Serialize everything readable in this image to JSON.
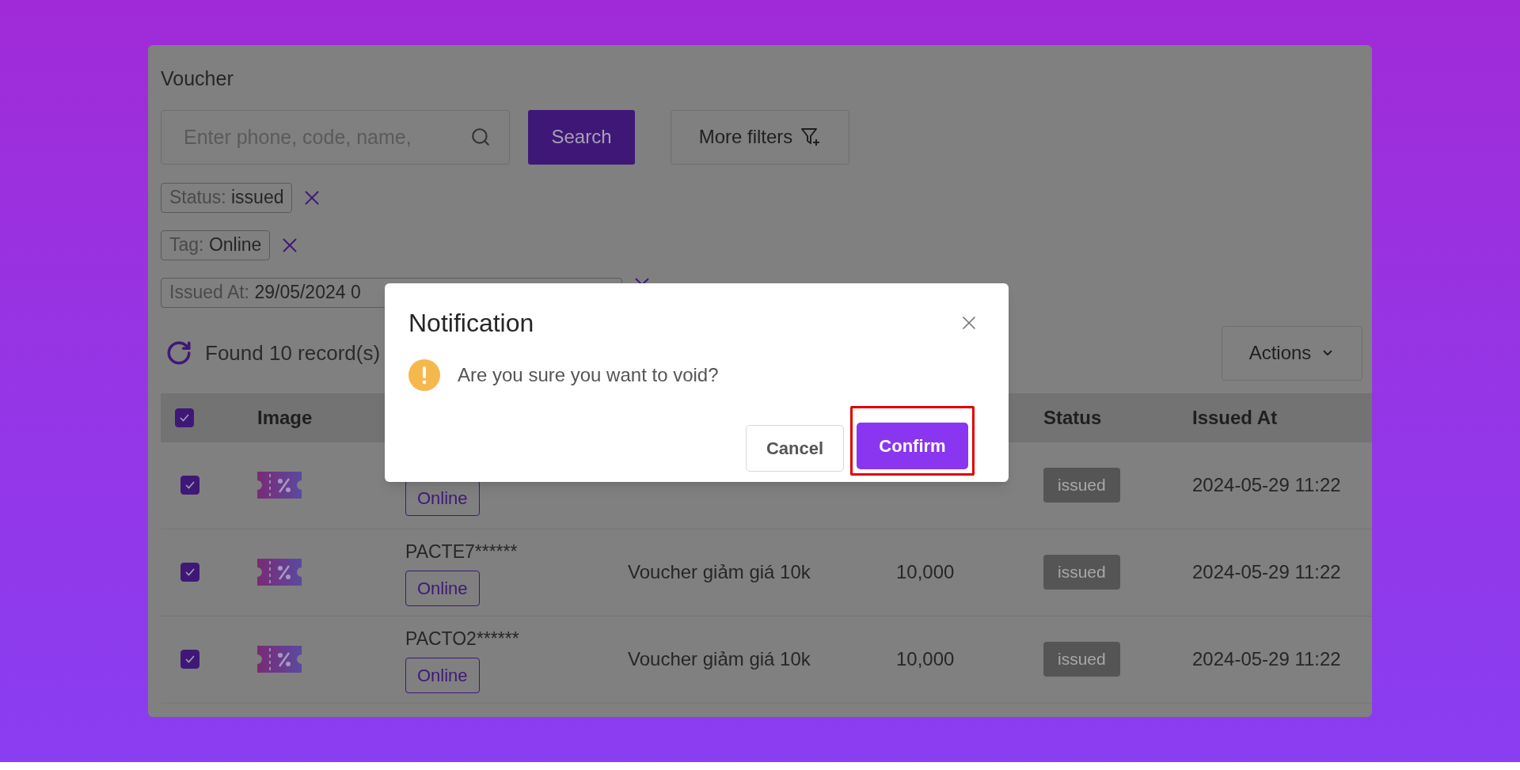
{
  "page_title": "Voucher",
  "search": {
    "placeholder": "Enter phone, code, name,",
    "button": "Search"
  },
  "more_filters": "More filters",
  "filters": [
    {
      "label": "Status: ",
      "value": "issued"
    },
    {
      "label": "Tag: ",
      "value": "Online"
    },
    {
      "label": "Issued At: ",
      "value": "29/05/2024 0"
    }
  ],
  "records_found": "Found 10 record(s)",
  "actions": "Actions",
  "table": {
    "select_all_checked": true,
    "columns": {
      "image": "Image",
      "status": "Status",
      "issued_at": "Issued At"
    },
    "rows": [
      {
        "checked": true,
        "tag": "Online",
        "status": "issued",
        "issued_at": "2024-05-29 11:22"
      },
      {
        "checked": true,
        "code": "PACTE7******",
        "tag": "Online",
        "name": "Voucher giảm giá 10k",
        "value": "10,000",
        "status": "issued",
        "issued_at": "2024-05-29 11:22"
      },
      {
        "checked": true,
        "code": "PACTO2******",
        "tag": "Online",
        "name": "Voucher giảm giá 10k",
        "value": "10,000",
        "status": "issued",
        "issued_at": "2024-05-29 11:22"
      }
    ]
  },
  "dialog": {
    "title": "Notification",
    "message": "Are you sure you want to void?",
    "cancel": "Cancel",
    "confirm": "Confirm",
    "confirm_highlighted": true
  }
}
